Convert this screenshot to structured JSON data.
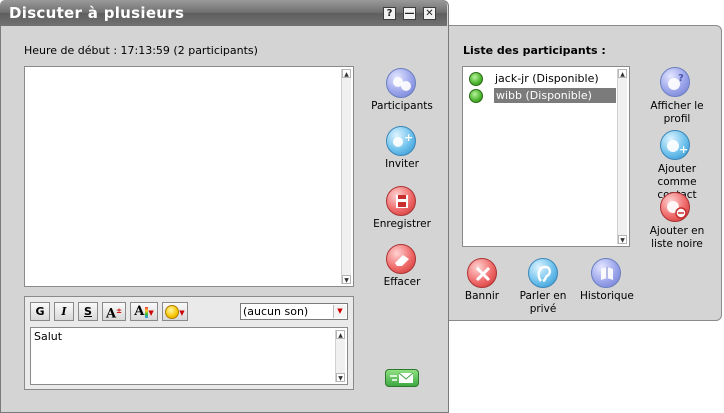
{
  "window": {
    "title": "Discuter à plusieurs"
  },
  "titlebar_buttons": {
    "help": "?",
    "minimize": "—",
    "close": "✕"
  },
  "session": {
    "start_label": "Heure de début : 17:13:59 (2 participants)"
  },
  "actions": {
    "participants": "Participants",
    "inviter": "Inviter",
    "enregistrer": "Enregistrer",
    "effacer": "Effacer"
  },
  "compose": {
    "bold": "G",
    "italic": "I",
    "strike": "S",
    "sound_value": "(aucun son)",
    "message": "Salut"
  },
  "participants_panel": {
    "heading": "Liste des participants :",
    "list": [
      {
        "name": "jack-jr (Disponible)",
        "selected": false
      },
      {
        "name": "wibb (Disponible)",
        "selected": true
      }
    ],
    "actions": {
      "view_profile": "Afficher le profil",
      "add_contact": "Ajouter comme contact",
      "blacklist": "Ajouter en liste noire",
      "ban": "Bannir",
      "private": "Parler en privé",
      "history": "Historique"
    }
  },
  "colors": {
    "selection": "#7b7b7b",
    "presence": "#4bb32d",
    "send": "#3fa845"
  }
}
